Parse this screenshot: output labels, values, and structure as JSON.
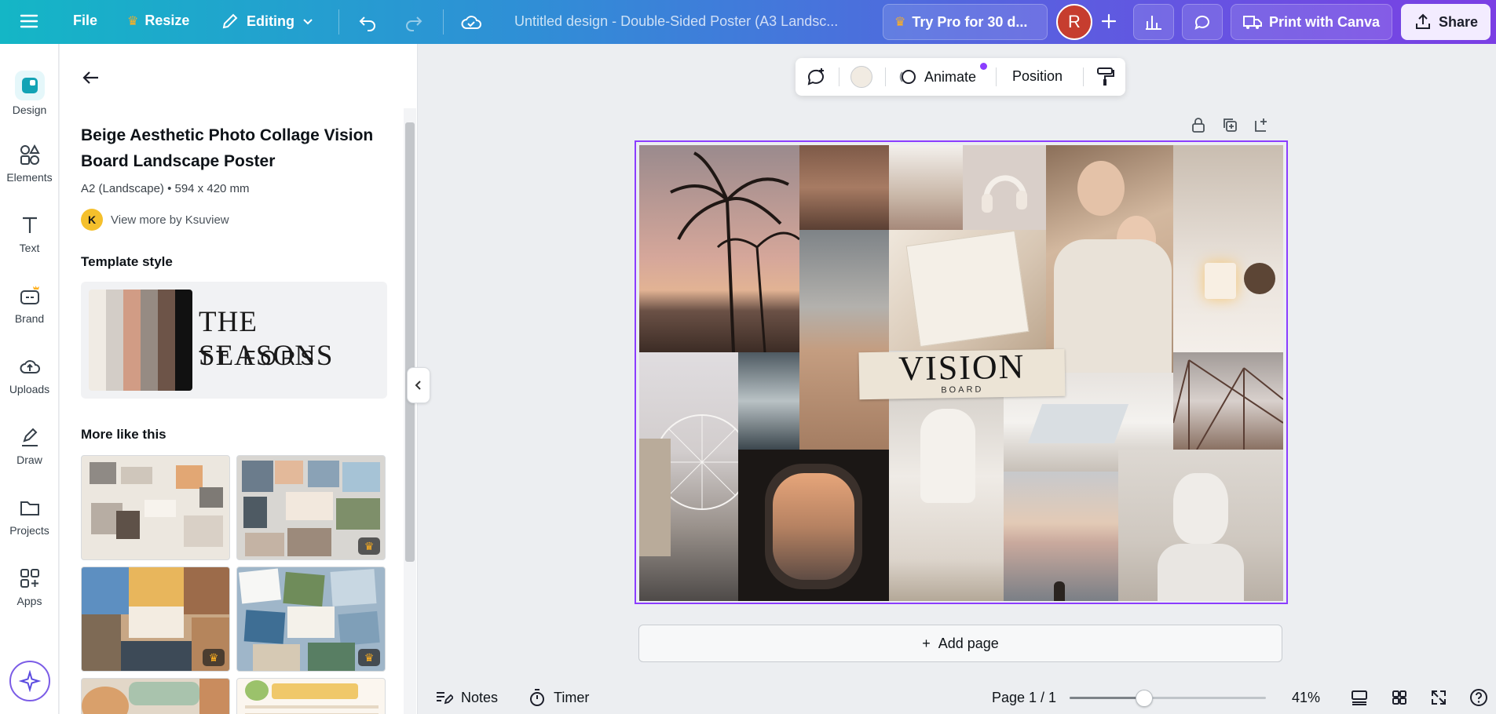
{
  "topbar": {
    "file_label": "File",
    "resize_label": "Resize",
    "editing_label": "Editing",
    "doc_title": "Untitled design - Double-Sided Poster (A3 Landsc...",
    "try_pro_label": "Try Pro for 30 d...",
    "avatar_initial": "R",
    "print_label": "Print with Canva",
    "share_label": "Share"
  },
  "rail": {
    "items": [
      {
        "label": "Design"
      },
      {
        "label": "Elements"
      },
      {
        "label": "Text"
      },
      {
        "label": "Brand"
      },
      {
        "label": "Uploads"
      },
      {
        "label": "Draw"
      },
      {
        "label": "Projects"
      },
      {
        "label": "Apps"
      }
    ]
  },
  "panel": {
    "template_title": "Beige Aesthetic Photo Collage Vision Board Landscape Poster",
    "template_size": "A2 (Landscape) • 594 x 420 mm",
    "author_initial": "K",
    "author_link": "View more by Ksuview",
    "template_style_heading": "Template style",
    "style_font_primary": "THE SEASONS",
    "style_font_secondary": "TT FORS",
    "swatches": [
      "#f0ebe4",
      "#d3cdc7",
      "#d19c85",
      "#968b83",
      "#6d5448",
      "#111111"
    ],
    "more_like_this_heading": "More like this"
  },
  "context_toolbar": {
    "animate_label": "Animate",
    "position_label": "Position"
  },
  "poster": {
    "vision_title": "VISION",
    "vision_subtitle": "BOARD"
  },
  "canvas": {
    "add_page_label": "Add page"
  },
  "bottombar": {
    "notes_label": "Notes",
    "timer_label": "Timer",
    "page_indicator": "Page 1 / 1",
    "zoom_level": "41%",
    "zoom_fraction": 0.41
  },
  "colors": {
    "accent_purple": "#8b3dff",
    "brand_teal": "#14b6c6"
  }
}
